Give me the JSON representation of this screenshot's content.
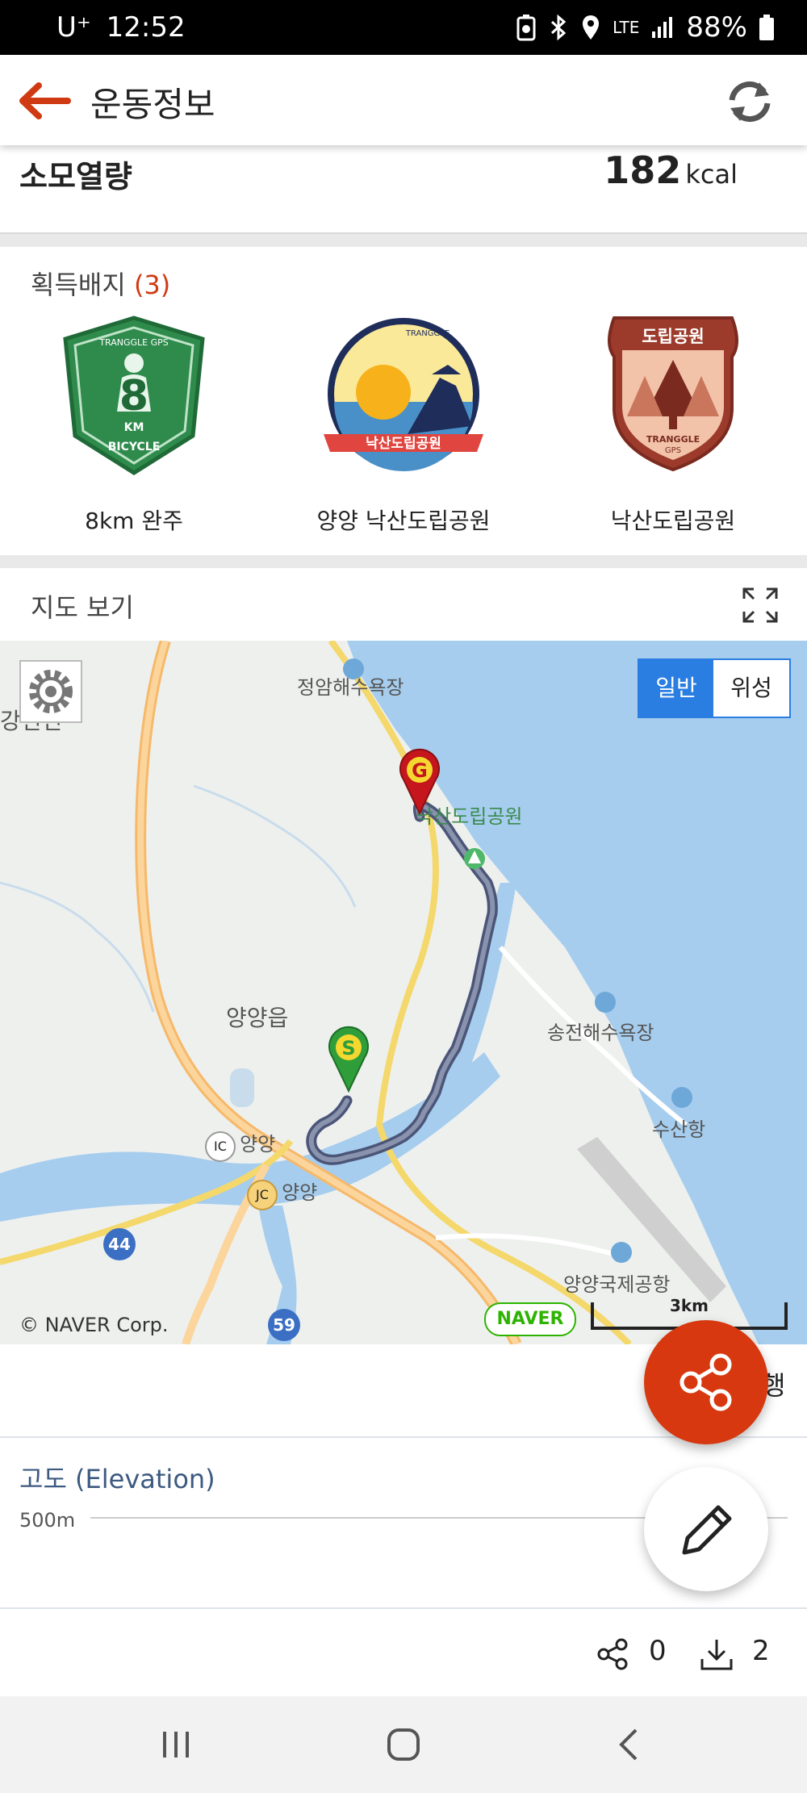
{
  "status_bar": {
    "carrier": "U⁺",
    "time": "12:52",
    "network": "LTE",
    "battery": "88%"
  },
  "header": {
    "title": "운동정보"
  },
  "calories": {
    "label": "소모열량",
    "value": "182",
    "unit": "kcal"
  },
  "badges": {
    "title": "획득배지",
    "count": "(3)",
    "items": [
      {
        "name": "8km 완주",
        "text_top": "TRANGGLE GPS",
        "text_mid": "8",
        "text_km": "KM",
        "text_bottom": "BICYCLE"
      },
      {
        "name": "양양 낙산도립공원",
        "text_top": "TRANGGLE",
        "ribbon": "낙산도립공원"
      },
      {
        "name": "낙산도립공원",
        "ribbon": "도립공원",
        "text_bottom": "TRANGGLE",
        "text_bottom2": "GPS"
      }
    ]
  },
  "map": {
    "section_title": "지도 보기",
    "toggle_general": "일반",
    "toggle_satellite": "위성",
    "labels": {
      "beach1": "정암해수욕장",
      "park": "낙산도립공원",
      "town": "양양읍",
      "ganghyeon": "강현면",
      "beach2": "송전해수욕장",
      "port": "수산항",
      "ic": "양양",
      "jc": "양양",
      "airport": "양양국제공항",
      "ic_tag": "IC",
      "jc_tag": "JC",
      "road44": "44",
      "road59": "59",
      "start_marker": "S",
      "goal_marker": "G"
    },
    "copyright": "© NAVER Corp.",
    "logo": "NAVER",
    "scale": "3km"
  },
  "share_text": "행",
  "elevation": {
    "title": "고도 (Elevation)",
    "tick": "500m"
  },
  "stats": {
    "shares": "0",
    "downloads": "2"
  },
  "colors": {
    "accent": "#d03a12",
    "sea": "#a6cdee",
    "toggle_active": "#2a7de1"
  }
}
